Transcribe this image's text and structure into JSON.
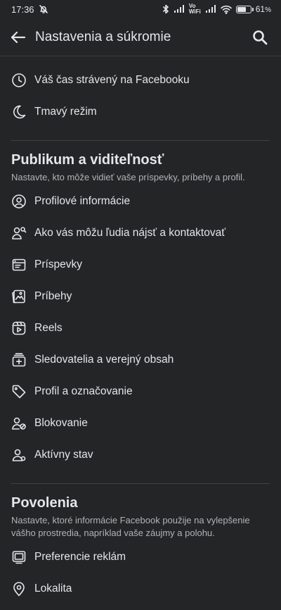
{
  "status": {
    "time": "17:36",
    "battery": "61",
    "battery_unit": "%",
    "network_label_top": "Vo",
    "network_label_bottom": "WiFi",
    "battery_level": 0.61
  },
  "header": {
    "title": "Nastavenia a súkromie"
  },
  "top_items": [
    {
      "label": "Váš čas strávený na Facebooku",
      "icon": "clock-icon"
    },
    {
      "label": "Tmavý režim",
      "icon": "moon-icon"
    }
  ],
  "audience": {
    "title": "Publikum a viditeľnosť",
    "subtitle": "Nastavte, kto môže vidieť vaše príspevky, príbehy a profil.",
    "items": [
      {
        "label": "Profilové informácie",
        "icon": "profile-icon"
      },
      {
        "label": "Ako vás môžu ľudia nájsť a kontaktovať",
        "icon": "find-contact-icon"
      },
      {
        "label": "Príspevky",
        "icon": "posts-icon"
      },
      {
        "label": "Príbehy",
        "icon": "stories-icon"
      },
      {
        "label": "Reels",
        "icon": "reels-icon"
      },
      {
        "label": "Sledovatelia a verejný obsah",
        "icon": "followers-icon"
      },
      {
        "label": "Profil a označovanie",
        "icon": "tag-icon"
      },
      {
        "label": "Blokovanie",
        "icon": "block-user-icon"
      },
      {
        "label": "Aktívny stav",
        "icon": "active-status-icon"
      }
    ]
  },
  "permissions": {
    "title": "Povolenia",
    "subtitle": "Nastavte, ktoré informácie Facebook použije na vylepšenie vášho prostredia, napríklad vaše záujmy a polohu.",
    "items": [
      {
        "label": "Preferencie reklám",
        "icon": "ads-icon"
      },
      {
        "label": "Lokalita",
        "icon": "location-pin-icon"
      }
    ]
  }
}
